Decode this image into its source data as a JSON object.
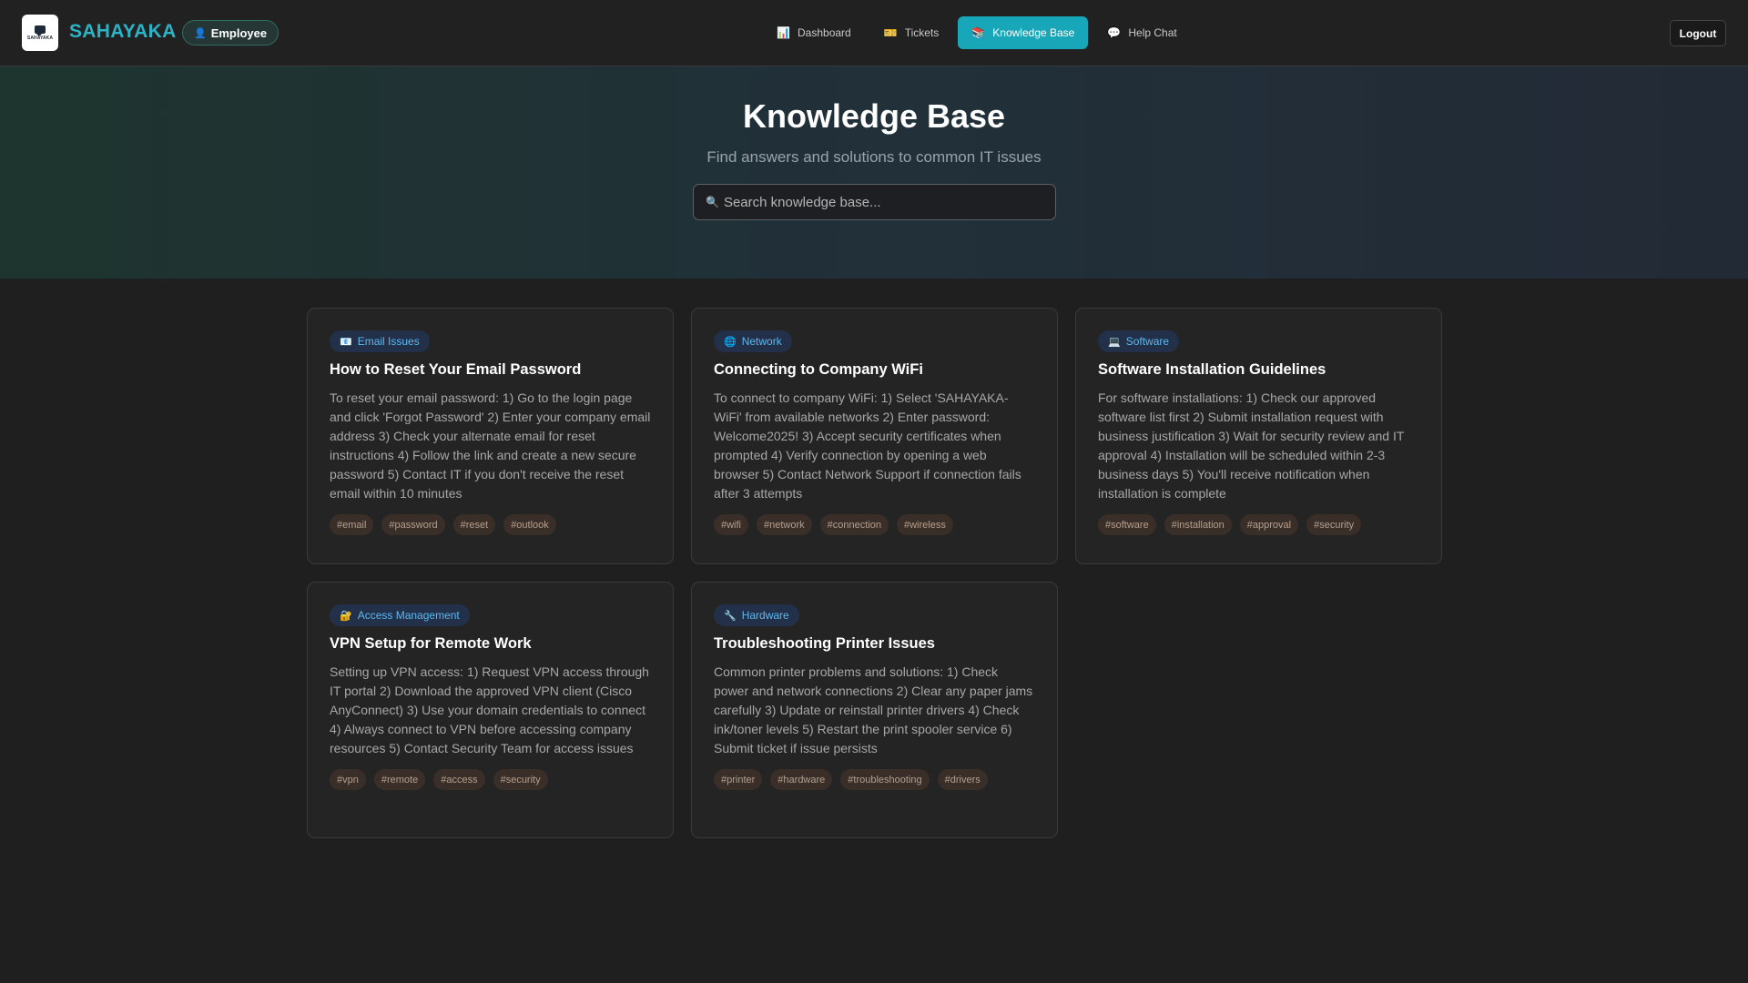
{
  "header": {
    "logo_text": "SAHAYAKA",
    "brand": "SAHAYAKA",
    "role_badge": "Employee",
    "nav": [
      {
        "label": "Dashboard",
        "icon": "bar-chart-icon",
        "glyph": "📊",
        "active": false
      },
      {
        "label": "Tickets",
        "icon": "ticket-icon",
        "glyph": "🎫",
        "active": false
      },
      {
        "label": "Knowledge Base",
        "icon": "books-icon",
        "glyph": "📚",
        "active": true
      },
      {
        "label": "Help Chat",
        "icon": "speech-bubble-icon",
        "glyph": "💬",
        "active": false
      }
    ],
    "logout_label": "Logout"
  },
  "hero": {
    "title": "Knowledge Base",
    "subtitle": "Find answers and solutions to common IT issues",
    "search_placeholder": "Search knowledge base..."
  },
  "articles": [
    {
      "category": "Email Issues",
      "category_icon": "email-icon",
      "category_glyph": "📧",
      "title": "How to Reset Your Email Password",
      "body": "To reset your email password: 1) Go to the login page and click 'Forgot Password' 2) Enter your company email address 3) Check your alternate email for reset instructions 4) Follow the link and create a new secure password 5) Contact IT if you don't receive the reset email within 10 minutes",
      "tags": [
        "#email",
        "#password",
        "#reset",
        "#outlook"
      ]
    },
    {
      "category": "Network",
      "category_icon": "globe-icon",
      "category_glyph": "🌐",
      "title": "Connecting to Company WiFi",
      "body": "To connect to company WiFi: 1) Select 'SAHAYAKA-WiFi' from available networks 2) Enter password: Welcome2025! 3) Accept security certificates when prompted 4) Verify connection by opening a web browser 5) Contact Network Support if connection fails after 3 attempts",
      "tags": [
        "#wifi",
        "#network",
        "#connection",
        "#wireless"
      ]
    },
    {
      "category": "Software",
      "category_icon": "laptop-icon",
      "category_glyph": "💻",
      "title": "Software Installation Guidelines",
      "body": "For software installations: 1) Check our approved software list first 2) Submit installation request with business justification 3) Wait for security review and IT approval 4) Installation will be scheduled within 2-3 business days 5) You'll receive notification when installation is complete",
      "tags": [
        "#software",
        "#installation",
        "#approval",
        "#security"
      ]
    },
    {
      "category": "Access Management",
      "category_icon": "lock-icon",
      "category_glyph": "🔐",
      "title": "VPN Setup for Remote Work",
      "body": "Setting up VPN access: 1) Request VPN access through IT portal 2) Download the approved VPN client (Cisco AnyConnect) 3) Use your domain credentials to connect 4) Always connect to VPN before accessing company resources 5) Contact Security Team for access issues",
      "tags": [
        "#vpn",
        "#remote",
        "#access",
        "#security"
      ]
    },
    {
      "category": "Hardware",
      "category_icon": "wrench-icon",
      "category_glyph": "🔧",
      "title": "Troubleshooting Printer Issues",
      "body": "Common printer problems and solutions: 1) Check power and network connections 2) Clear any paper jams carefully 3) Update or reinstall printer drivers 4) Check ink/toner levels 5) Restart the print spooler service 6) Submit ticket if issue persists",
      "tags": [
        "#printer",
        "#hardware",
        "#troubleshooting",
        "#drivers"
      ]
    }
  ]
}
